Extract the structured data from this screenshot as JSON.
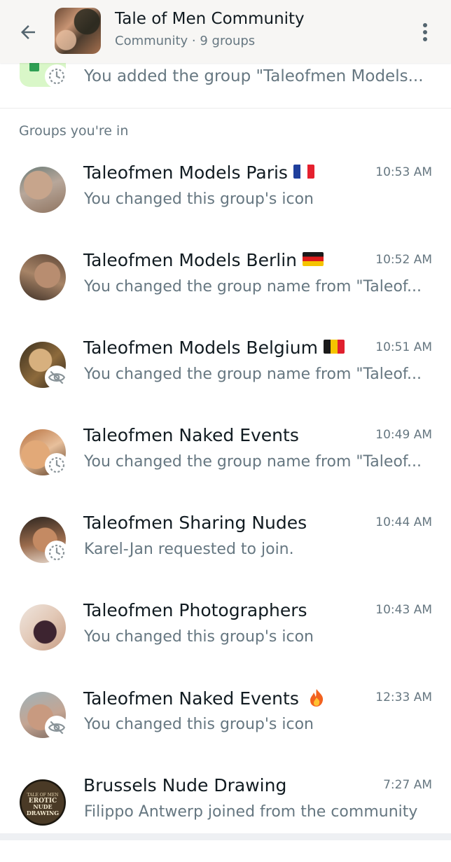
{
  "header": {
    "title": "Tale of Men Community",
    "subtitle": "Community · 9 groups",
    "back_icon": "arrow-left-icon",
    "menu_icon": "more-vertical-icon"
  },
  "announcement": {
    "preview": "You added the group \"Taleofmen Models...",
    "badge_icon": "disappearing-timer-icon"
  },
  "section_label": "Groups you're in",
  "colors": {
    "header_bg": "#f7f6f4",
    "primary_text": "#111b21",
    "secondary_text": "#667781",
    "announcement_avatar_bg": "#d9f7c8"
  },
  "groups": [
    {
      "name": "Taleofmen Models Paris",
      "emoji": "france-flag",
      "time": "10:53 AM",
      "preview": "You changed this group's icon",
      "badge": ""
    },
    {
      "name": "Taleofmen Models Berlin",
      "emoji": "germany-flag",
      "time": "10:52 AM",
      "preview": "You changed the group name from \"Taleof...",
      "badge": ""
    },
    {
      "name": "Taleofmen Models Belgium",
      "emoji": "belgium-flag",
      "time": "10:51 AM",
      "preview": "You changed the group name from \"Taleof...",
      "badge": "eye-off-icon"
    },
    {
      "name": "Taleofmen Naked Events",
      "emoji": "",
      "time": "10:49 AM",
      "preview": "You changed the group name from \"Taleof...",
      "badge": "disappearing-timer-icon"
    },
    {
      "name": "Taleofmen Sharing Nudes",
      "emoji": "",
      "time": "10:44 AM",
      "preview": "Karel-Jan requested to join.",
      "badge": "disappearing-timer-icon"
    },
    {
      "name": "Taleofmen Photographers",
      "emoji": "",
      "time": "10:43 AM",
      "preview": "You changed this group's icon",
      "badge": ""
    },
    {
      "name": "Taleofmen Naked Events",
      "emoji": "fire-emoji",
      "time": "12:33 AM",
      "preview": "You changed this group's icon",
      "badge": "eye-off-icon"
    },
    {
      "name": "Brussels Nude Drawing",
      "emoji": "",
      "time": "7:27 AM",
      "preview": "Filippo Antwerp joined from the community",
      "badge": "",
      "avatar_text": "TALE OF MEN EROTIC NUDE DRAWING"
    }
  ]
}
